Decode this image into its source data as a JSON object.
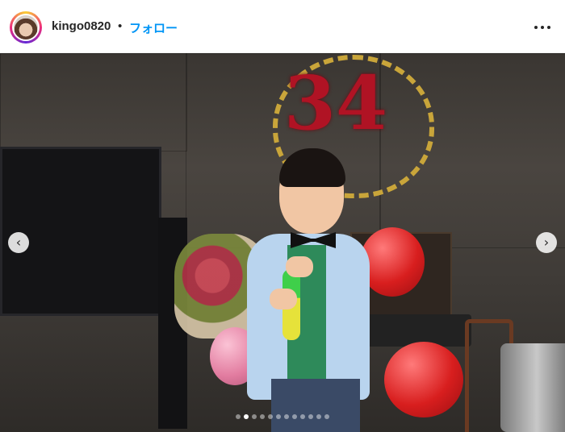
{
  "header": {
    "username": "kingo0820",
    "separator": "•",
    "follow_label": "フォロー",
    "more_icon": "more-horizontal-icon"
  },
  "post": {
    "sign_text": "34",
    "carousel": {
      "total": 12,
      "active_index": 1,
      "prev_icon": "chevron-left-icon",
      "next_icon": "chevron-right-icon"
    }
  },
  "colors": {
    "follow": "#0095f6",
    "username": "#262626"
  }
}
